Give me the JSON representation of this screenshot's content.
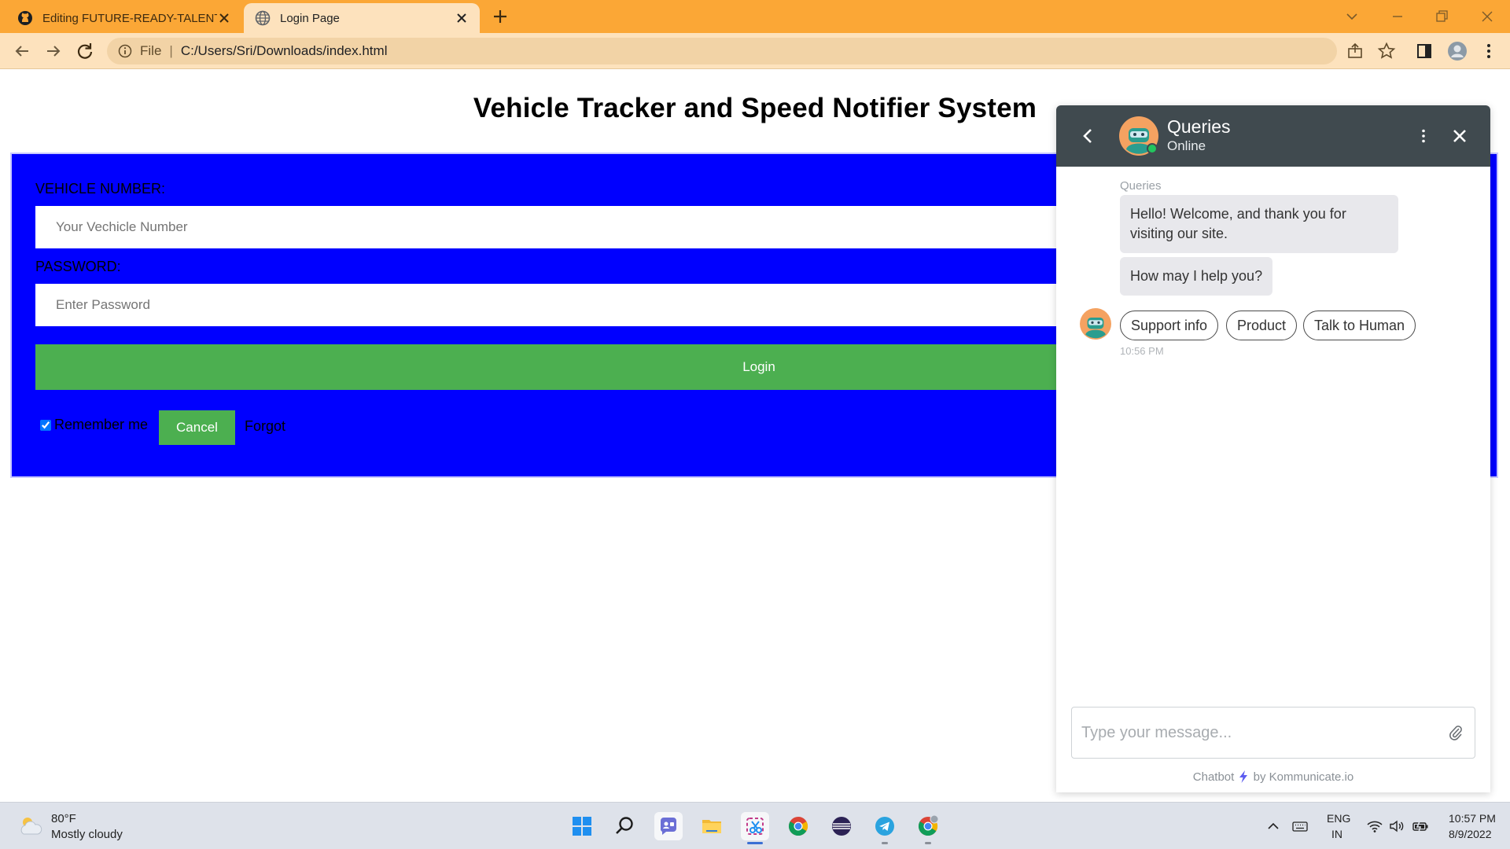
{
  "browser": {
    "tabs": [
      {
        "title": "Editing FUTURE-READY-TALENT/",
        "active": false,
        "favicon": "github-icon"
      },
      {
        "title": "Login Page",
        "active": true,
        "favicon": "globe-icon"
      }
    ],
    "address_scheme": "File",
    "address_url": "C:/Users/Sri/Downloads/index.html",
    "theme_color": "#fba736"
  },
  "page": {
    "title": "Vehicle Tracker and Speed Notifier System",
    "panel_color": "#0000ff",
    "vehicle_label": "VEHICLE NUMBER:",
    "vehicle_placeholder": "Your Vechicle Number",
    "password_label": "PASSWORD:",
    "password_placeholder": "Enter Password",
    "login_label": "Login",
    "remember_label": "Remember me",
    "remember_checked": true,
    "cancel_label": "Cancel",
    "forgot_label": "Forgot",
    "button_color": "#4caf50"
  },
  "chat": {
    "bot_name": "Queries",
    "status": "Online",
    "sender": "Queries",
    "messages": [
      "Hello! Welcome, and thank you for visiting our site.",
      "How may I help you?"
    ],
    "quick_replies": [
      "Support info",
      "Product",
      "Talk to Human"
    ],
    "time": "10:56 PM",
    "input_placeholder": "Type your message...",
    "powered_prefix": "Chatbot",
    "powered_suffix": "by Kommunicate.io",
    "header_color": "#404a4f"
  },
  "taskbar": {
    "weather_temp": "80°F",
    "weather_desc": "Mostly cloudy",
    "lang_line1": "ENG",
    "lang_line2": "IN",
    "time": "10:57 PM",
    "date": "8/9/2022"
  }
}
